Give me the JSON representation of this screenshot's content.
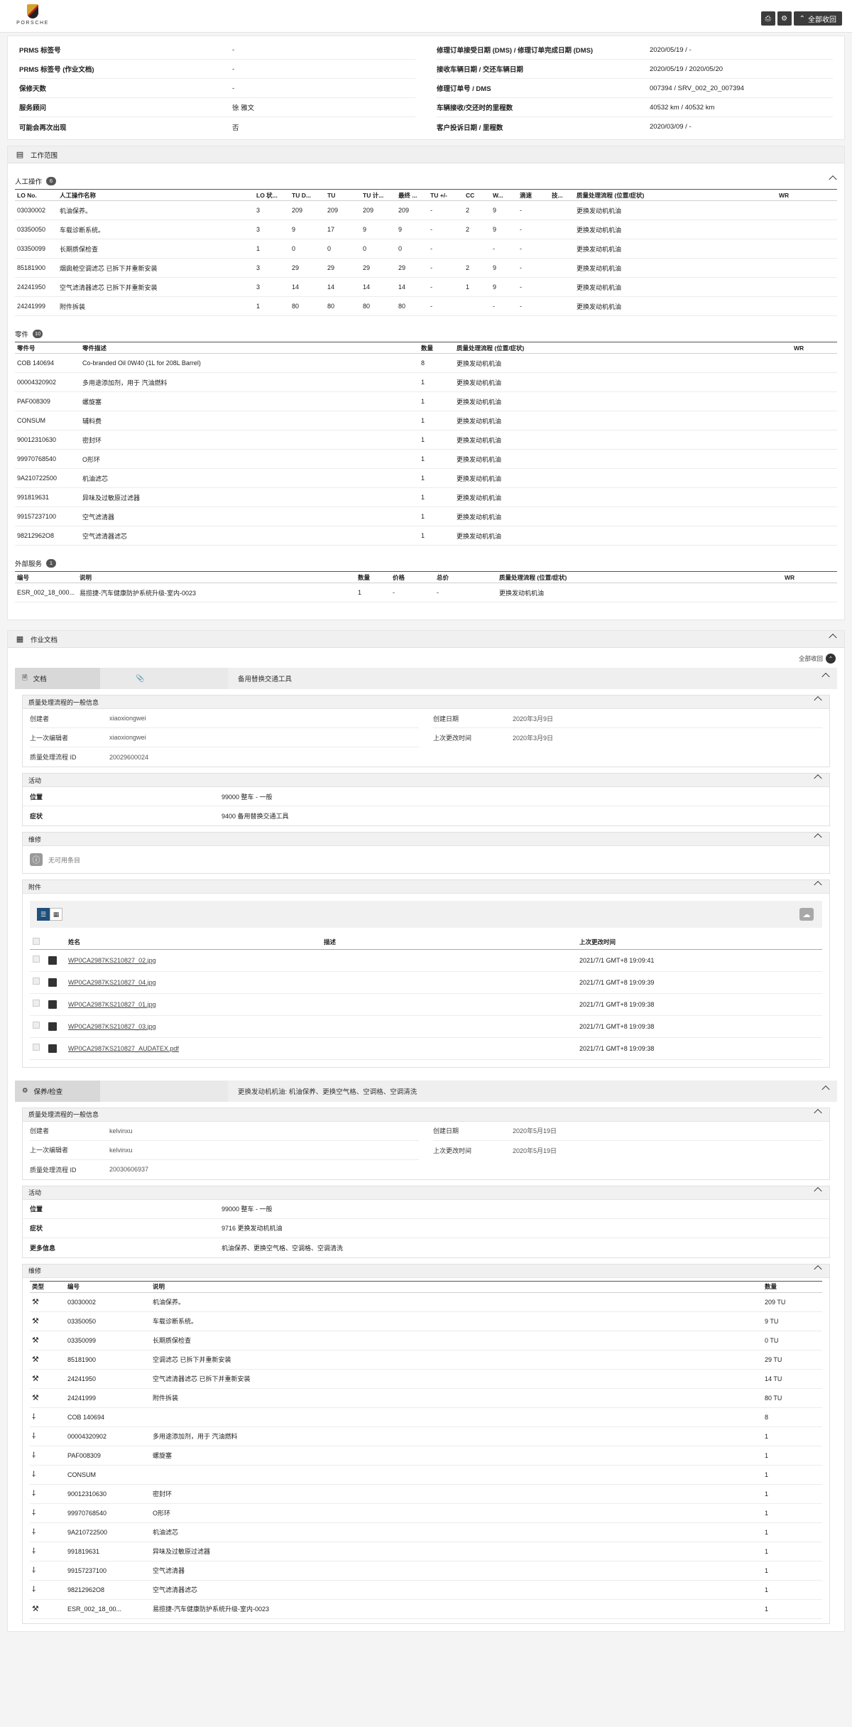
{
  "header": {
    "logo_text": "PORSCHE",
    "collapse_all": "全部收回"
  },
  "summary": {
    "left": [
      {
        "k": "PRMS 标签号",
        "v": "-"
      },
      {
        "k": "PRMS 标签号 (作业文档)",
        "v": "-"
      },
      {
        "k": "保修天数",
        "v": "-"
      },
      {
        "k": "服务顾问",
        "v": "徐 雅文"
      },
      {
        "k": "可能会再次出现",
        "v": "否"
      }
    ],
    "right": [
      {
        "k": "修理订单接受日期 (DMS) / 修理订单完成日期 (DMS)",
        "v": "2020/05/19 / -"
      },
      {
        "k": "接收车辆日期 / 交还车辆日期",
        "v": "2020/05/19 / 2020/05/20"
      },
      {
        "k": "修理订单号 / DMS",
        "v": "007394 / SRV_002_20_007394"
      },
      {
        "k": "车辆接收/交还时的里程数",
        "v": "40532 km / 40532 km"
      },
      {
        "k": "客户投诉日期 / 里程数",
        "v": "2020/03/09 / -"
      }
    ]
  },
  "work_scope": {
    "title": "工作范围",
    "labor": {
      "title": "人工操作",
      "count": "6",
      "headers": [
        "LO No.",
        "人工操作名称",
        "LO 状...",
        "TU D...",
        "TU",
        "TU 计...",
        "最终 ...",
        "TU +/-",
        "CC",
        "W...",
        "滴速",
        "技...",
        "质量处理流程 (位置/症状)",
        "WR"
      ],
      "rows": [
        [
          "03030002",
          "机油保养。",
          "3",
          "209",
          "209",
          "209",
          "209",
          "-",
          "2",
          "9",
          "-",
          "",
          "更换发动机机油",
          ""
        ],
        [
          "03350050",
          "车载诊断系统。",
          "3",
          "9",
          "17",
          "9",
          "9",
          "-",
          "2",
          "9",
          "-",
          "",
          "更换发动机机油",
          ""
        ],
        [
          "03350099",
          "长期质保检查",
          "1",
          "0",
          "0",
          "0",
          "0",
          "-",
          "",
          "-",
          "-",
          "",
          "更换发动机机油",
          ""
        ],
        [
          "85181900",
          "烟囱舱空调滤芯 已拆下并重新安装",
          "3",
          "29",
          "29",
          "29",
          "29",
          "-",
          "2",
          "9",
          "-",
          "",
          "更换发动机机油",
          ""
        ],
        [
          "24241950",
          "空气滤清器滤芯 已拆下并重新安装",
          "3",
          "14",
          "14",
          "14",
          "14",
          "-",
          "1",
          "9",
          "-",
          "",
          "更换发动机机油",
          ""
        ],
        [
          "24241999",
          "附件拆装",
          "1",
          "80",
          "80",
          "80",
          "80",
          "-",
          "",
          "-",
          "-",
          "",
          "更换发动机机油",
          ""
        ]
      ]
    },
    "parts": {
      "title": "零件",
      "count": "10",
      "headers": [
        "零件号",
        "零件描述",
        "数量",
        "质量处理流程 (位置/症状)",
        "WR"
      ],
      "rows": [
        [
          "COB 140694",
          "Co-branded Oil 0W40 (1L for 208L Barrel)",
          "8",
          "更换发动机机油",
          ""
        ],
        [
          "00004320902",
          "多用途添加剂，用于 汽油燃料",
          "1",
          "更换发动机机油",
          ""
        ],
        [
          "PAF008309",
          "螺旋塞",
          "1",
          "更换发动机机油",
          ""
        ],
        [
          "CONSUM",
          "辅料费",
          "1",
          "更换发动机机油",
          ""
        ],
        [
          "90012310630",
          "密封环",
          "1",
          "更换发动机机油",
          ""
        ],
        [
          "99970768540",
          "O形环",
          "1",
          "更换发动机机油",
          ""
        ],
        [
          "9A210722500",
          "机油滤芯",
          "1",
          "更换发动机机油",
          ""
        ],
        [
          "991819631",
          "异味及过敏原过滤器",
          "1",
          "更换发动机机油",
          ""
        ],
        [
          "99157237100",
          "空气滤清器",
          "1",
          "更换发动机机油",
          ""
        ],
        [
          "98212962O8",
          "空气滤清器滤芯",
          "1",
          "更换发动机机油",
          ""
        ]
      ]
    },
    "external": {
      "title": "外部服务",
      "count": "1",
      "headers": [
        "编号",
        "说明",
        "数量",
        "价格",
        "总价",
        "质量处理流程 (位置/症状)",
        "WR"
      ],
      "rows": [
        [
          "ESR_002_18_000...",
          "易揽捷-汽车健康防护系统升级-室内-0023",
          "1",
          "-",
          "-",
          "更换发动机机油",
          ""
        ]
      ]
    }
  },
  "work_docs": {
    "title": "作业文档",
    "collapse_all": "全部收回",
    "doc1": {
      "tab": "文档",
      "desc": "备用替换交通工具",
      "general": {
        "title": "质量处理流程的一般信息",
        "left": [
          {
            "k": "创建者",
            "v": "xiaoxiongwei"
          },
          {
            "k": "上一次编辑者",
            "v": "xiaoxiongwei"
          },
          {
            "k": "质量处理流程 ID",
            "v": "20029600024"
          }
        ],
        "right": [
          {
            "k": "创建日期",
            "v": "2020年3月9日"
          },
          {
            "k": "上次更改时间",
            "v": "2020年3月9日"
          }
        ]
      },
      "activity": {
        "title": "活动",
        "rows": [
          {
            "k": "位置",
            "v": "99000 整车 - 一般"
          },
          {
            "k": "症状",
            "v": "9400 备用替换交通工具"
          }
        ]
      },
      "repair": {
        "title": "维修",
        "empty": "无可用条目"
      },
      "attachments": {
        "title": "附件",
        "headers": [
          "姓名",
          "描述",
          "上次更改时间"
        ],
        "rows": [
          [
            "WP0CA2987KS210827_02.jpg",
            "",
            "2021/7/1 GMT+8 19:09:41"
          ],
          [
            "WP0CA2987KS210827_04.jpg",
            "",
            "2021/7/1 GMT+8 19:09:39"
          ],
          [
            "WP0CA2987KS210827_01.jpg",
            "",
            "2021/7/1 GMT+8 19:09:38"
          ],
          [
            "WP0CA2987KS210827_03.jpg",
            "",
            "2021/7/1 GMT+8 19:09:38"
          ],
          [
            "WP0CA2987KS210827_AUDATEX.pdf",
            "",
            "2021/7/1 GMT+8 19:09:38"
          ]
        ]
      }
    },
    "doc2": {
      "tab": "保养/检查",
      "desc": "更换发动机机油: 机油保养、更换空气格、空调格、空调清洗",
      "general": {
        "title": "质量处理流程的一般信息",
        "left": [
          {
            "k": "创建者",
            "v": "kelvinxu"
          },
          {
            "k": "上一次编辑者",
            "v": "kelvinxu"
          },
          {
            "k": "质量处理流程 ID",
            "v": "20030606937"
          }
        ],
        "right": [
          {
            "k": "创建日期",
            "v": "2020年5月19日"
          },
          {
            "k": "上次更改时间",
            "v": "2020年5月19日"
          }
        ]
      },
      "activity": {
        "title": "活动",
        "rows": [
          {
            "k": "位置",
            "v": "99000 整车 - 一般"
          },
          {
            "k": "症状",
            "v": "9716 更换发动机机油"
          },
          {
            "k": "更多信息",
            "v": "机油保养、更换空气格、空调格、空调清洗"
          }
        ]
      },
      "repair": {
        "title": "维修",
        "headers": [
          "类型",
          "编号",
          "说明",
          "数量"
        ],
        "rows": [
          [
            "labor",
            "03030002",
            "机油保养。",
            "209 TU"
          ],
          [
            "labor",
            "03350050",
            "车载诊断系统。",
            "9 TU"
          ],
          [
            "labor",
            "03350099",
            "长期质保检查",
            "0 TU"
          ],
          [
            "labor",
            "85181900",
            "空调滤芯 已拆下并重新安装",
            "29 TU"
          ],
          [
            "labor",
            "24241950",
            "空气滤清器滤芯 已拆下并重新安装",
            "14 TU"
          ],
          [
            "labor",
            "24241999",
            "附件拆装",
            "80 TU"
          ],
          [
            "part",
            "COB 140694",
            "",
            "8"
          ],
          [
            "part",
            "00004320902",
            "多用途添加剂，用于 汽油燃料",
            "1"
          ],
          [
            "part",
            "PAF008309",
            "螺旋塞",
            "1"
          ],
          [
            "part",
            "CONSUM",
            "",
            "1"
          ],
          [
            "part",
            "90012310630",
            "密封环",
            "1"
          ],
          [
            "part",
            "99970768540",
            "O形环",
            "1"
          ],
          [
            "part",
            "9A210722500",
            "机油滤芯",
            "1"
          ],
          [
            "part",
            "991819631",
            "异味及过敏原过滤器",
            "1"
          ],
          [
            "part",
            "99157237100",
            "空气滤清器",
            "1"
          ],
          [
            "part",
            "98212962O8",
            "空气滤清器滤芯",
            "1"
          ],
          [
            "external",
            "ESR_002_18_00...",
            "易揽捷-汽车健康防护系统升级-室内-0023",
            "1"
          ]
        ]
      }
    }
  },
  "icons": {
    "print": "print-icon",
    "gear": "gear-icon",
    "collapse": "chevron-up-icon",
    "work_scope": "clipboard-icon",
    "docs": "document-icon",
    "attach": "paperclip-icon",
    "wrench": "wrench-icon",
    "screwdriver": "screwdriver-icon"
  },
  "colors": {
    "dark_button": "#3c3c3c",
    "active_view": "#1f4f7a"
  }
}
